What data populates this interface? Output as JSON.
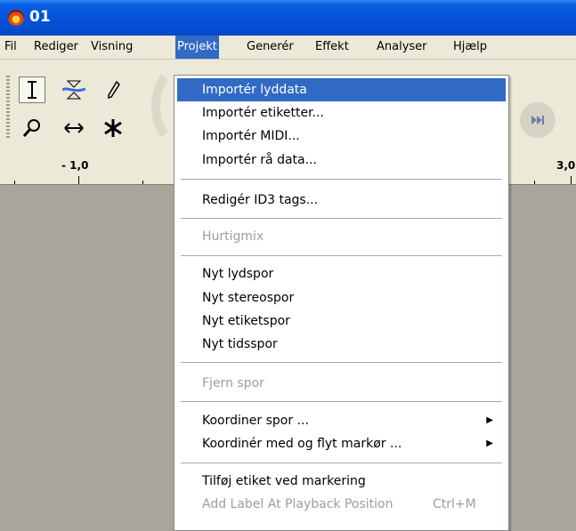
{
  "window": {
    "title": "01"
  },
  "menubar": {
    "items": [
      "Fil",
      "Rediger",
      "Visning",
      "Projekt",
      "Generér",
      "Effekt",
      "Analyser",
      "Hjælp"
    ]
  },
  "ruler": {
    "left_label": "- 1,0",
    "right_label": "3,0"
  },
  "menu": {
    "items": [
      {
        "label": "Importér lyddata",
        "state": "highlighted"
      },
      {
        "label": "Importér etiketter..."
      },
      {
        "label": "Importér MIDI..."
      },
      {
        "label": "Importér rå data..."
      },
      {
        "label": "Redigér ID3 tags..."
      },
      {
        "label": "Hurtigmix",
        "state": "disabled"
      },
      {
        "label": "Nyt lydspor"
      },
      {
        "label": "Nyt stereospor"
      },
      {
        "label": "Nyt etiketspor"
      },
      {
        "label": "Nyt tidsspor"
      },
      {
        "label": "Fjern spor",
        "state": "disabled"
      },
      {
        "label": "Koordiner spor ...",
        "submenu": true
      },
      {
        "label": "Koordinér med og flyt markør ...",
        "submenu": true
      },
      {
        "label": "Tilføj etiket ved markering"
      },
      {
        "label": "Add Label At Playback Position",
        "state": "disabled",
        "shortcut": "Ctrl+M"
      }
    ]
  },
  "colors": {
    "highlight": "#316ac5",
    "titlebar": "#0451d8",
    "workspace": "#a9a79b"
  },
  "icons": [
    "select-tool-icon",
    "envelope-tool-icon",
    "draw-tool-icon",
    "zoom-tool-icon",
    "timeshift-tool-icon",
    "multi-tool-icon",
    "skip-end-icon"
  ]
}
